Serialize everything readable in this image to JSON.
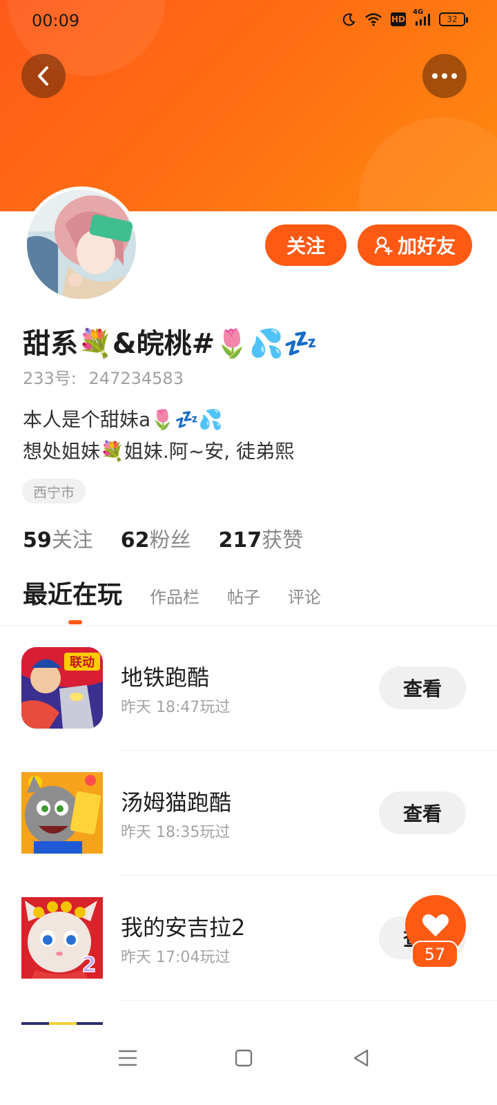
{
  "status_bar": {
    "time": "00:09",
    "hd_label": "HD",
    "network_label": "4G",
    "battery": "32"
  },
  "header": {
    "back_icon": "chevron-left-icon",
    "more_icon": "ellipsis-icon"
  },
  "profile": {
    "follow_label": "关注",
    "add_friend_label": "加好友",
    "nickname": "甜系💐&皖桃#🌷💦💤",
    "uid_prefix": "233号:",
    "uid": "247234583",
    "bio_line1": "本人是个甜妹a🌷💤💦",
    "bio_line2": "想处姐妹💐姐妹.阿~安, 徒弟熙",
    "location": "西宁市"
  },
  "stats": [
    {
      "num": "59",
      "label": "关注"
    },
    {
      "num": "62",
      "label": "粉丝"
    },
    {
      "num": "217",
      "label": "获赞"
    }
  ],
  "tabs": [
    {
      "label": "最近在玩",
      "active": true
    },
    {
      "label": "作品栏",
      "active": false
    },
    {
      "label": "帖子",
      "active": false
    },
    {
      "label": "评论",
      "active": false
    }
  ],
  "games": [
    {
      "name": "地铁跑酷",
      "time": "昨天 18:47玩过",
      "button": "查看",
      "icon": "subway-surfers-icon",
      "badge": "联动"
    },
    {
      "name": "汤姆猫跑酷",
      "time": "昨天 18:35玩过",
      "button": "查看",
      "icon": "talking-tom-gold-run-icon"
    },
    {
      "name": "我的安吉拉2",
      "time": "昨天 17:04玩过",
      "button": "查看",
      "icon": "my-talking-angela-2-icon",
      "badge": "2"
    }
  ],
  "like": {
    "count": "57",
    "icon": "heart-icon"
  },
  "colors": {
    "accent": "#ff5a14",
    "banner_start": "#ff5a1a",
    "banner_end": "#ff8a10"
  }
}
